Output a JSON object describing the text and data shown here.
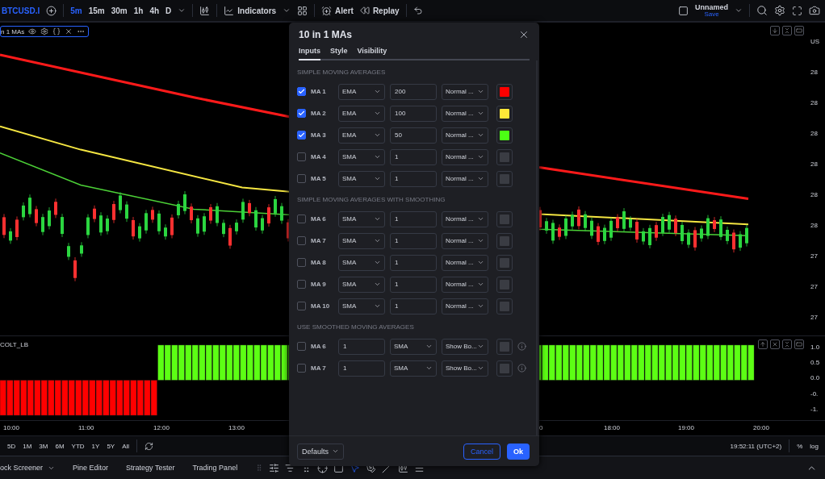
{
  "toolbar": {
    "symbol": "BTCUSD.I",
    "intervals": [
      {
        "label": "5m",
        "selected": true
      },
      {
        "label": "15m",
        "selected": false
      },
      {
        "label": "30m",
        "selected": false
      },
      {
        "label": "1h",
        "selected": false
      },
      {
        "label": "4h",
        "selected": false
      },
      {
        "label": "D",
        "selected": false
      }
    ],
    "indicators": "Indicators",
    "alert": "Alert",
    "replay": "Replay",
    "layout_name": "Unnamed",
    "layout_status": "Save"
  },
  "legend": {
    "title": "n 1 MAs"
  },
  "price_axis": [
    "US",
    "28",
    "28",
    "28",
    "28",
    "28",
    "28",
    "27",
    "27",
    "27"
  ],
  "indicator_pane": {
    "title": "COLT_LB",
    "axis": [
      "1.0",
      "0.5",
      "0.0",
      "-0.",
      "-1."
    ]
  },
  "time_axis": [
    "10:00",
    "11:00",
    "12:00",
    "13:00",
    "0",
    "18:00",
    "19:00",
    "20:00"
  ],
  "range_bar": {
    "ranges": [
      "5D",
      "1M",
      "3M",
      "6M",
      "YTD",
      "1Y",
      "5Y",
      "All"
    ],
    "clock": "19:52:11 (UTC+2)",
    "percent": "%",
    "log": "log"
  },
  "bottom_tabs": [
    "ock Screener",
    "Pine Editor",
    "Strategy Tester",
    "Trading Panel"
  ],
  "dialog": {
    "title": "10 in 1 MAs",
    "tabs": [
      {
        "label": "Inputs",
        "selected": true
      },
      {
        "label": "Style",
        "selected": false
      },
      {
        "label": "Visibility",
        "selected": false
      }
    ],
    "sections": [
      {
        "heading": "SIMPLE MOVING AVERAGES",
        "rows": [
          {
            "kind": "ma",
            "checked": true,
            "label": "MA 1",
            "type": "EMA",
            "length": "200",
            "mode": "Normal ...",
            "color": "#ff0000"
          },
          {
            "kind": "ma",
            "checked": true,
            "label": "MA 2",
            "type": "EMA",
            "length": "100",
            "mode": "Normal ...",
            "color": "#ffe838"
          },
          {
            "kind": "ma",
            "checked": true,
            "label": "MA 3",
            "type": "EMA",
            "length": "50",
            "mode": "Normal ...",
            "color": "#4cff14"
          },
          {
            "kind": "ma",
            "checked": false,
            "label": "MA 4",
            "type": "SMA",
            "length": "1",
            "mode": "Normal ...",
            "color": "#3a3c43"
          },
          {
            "kind": "ma",
            "checked": false,
            "label": "MA 5",
            "type": "SMA",
            "length": "1",
            "mode": "Normal ...",
            "color": "#3a3c43"
          }
        ]
      },
      {
        "heading": "SIMPLE MOVING AVERAGES WITH SMOOTHING",
        "rows": [
          {
            "kind": "ma",
            "checked": false,
            "label": "MA 6",
            "type": "SMA",
            "length": "1",
            "mode": "Normal ...",
            "color": "#3a3c43"
          },
          {
            "kind": "ma",
            "checked": false,
            "label": "MA 7",
            "type": "SMA",
            "length": "1",
            "mode": "Normal ...",
            "color": "#3a3c43"
          },
          {
            "kind": "ma",
            "checked": false,
            "label": "MA 8",
            "type": "SMA",
            "length": "1",
            "mode": "Normal ...",
            "color": "#3a3c43"
          },
          {
            "kind": "ma",
            "checked": false,
            "label": "MA 9",
            "type": "SMA",
            "length": "1",
            "mode": "Normal ...",
            "color": "#3a3c43"
          },
          {
            "kind": "ma",
            "checked": false,
            "label": "MA 10",
            "type": "SMA",
            "length": "1",
            "mode": "Normal ...",
            "color": "#3a3c43"
          }
        ]
      },
      {
        "heading": "USE SMOOTHED MOVING AVERAGES",
        "rows": [
          {
            "kind": "smoothed",
            "checked": false,
            "label": "MA 6",
            "length": "1",
            "type": "SMA",
            "mode": "Show Bo...",
            "color": "#3a3c43"
          },
          {
            "kind": "smoothed",
            "checked": false,
            "label": "MA 7",
            "length": "1",
            "type": "SMA",
            "mode": "Show Bo...",
            "color": "#3a3c43"
          }
        ]
      }
    ],
    "defaults": "Defaults",
    "cancel": "Cancel",
    "ok": "Ok"
  }
}
